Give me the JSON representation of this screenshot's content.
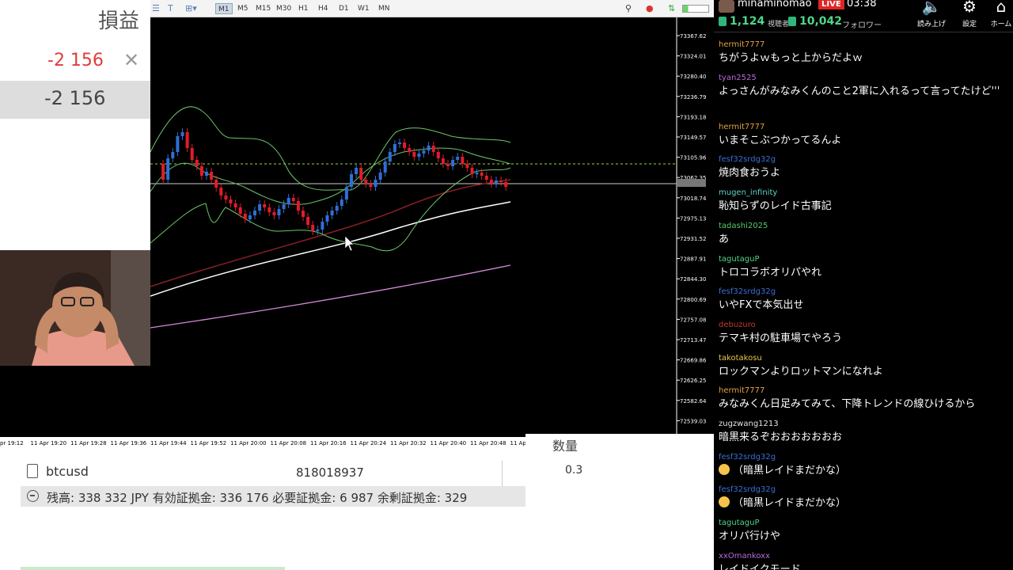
{
  "left_panel": {
    "title": "損益",
    "value": "-2 156",
    "close_symbol": "✕",
    "total": "-2 156"
  },
  "toolbar": {
    "timeframes": [
      "M1",
      "M5",
      "M15",
      "M30",
      "H1",
      "H4",
      "D1",
      "W1",
      "MN"
    ],
    "active_timeframe": "M1"
  },
  "chart": {
    "price_levels": [
      "73367.62",
      "73324.01",
      "73280.40",
      "73236.79",
      "73193.18",
      "73149.57",
      "73105.96",
      "73062.35",
      "73018.74",
      "72975.13",
      "72931.52",
      "72887.91",
      "72844.30",
      "72800.69",
      "72757.08",
      "72713.47",
      "72669.86",
      "72626.25",
      "72582.64",
      "72539.03"
    ],
    "time_labels": [
      "pr 19:12",
      "11 Apr 19:20",
      "11 Apr 19:28",
      "11 Apr 19:36",
      "11 Apr 19:44",
      "11 Apr 19:52",
      "11 Apr 20:00",
      "11 Apr 20:08",
      "11 Apr 20:16",
      "11 Apr 20:24",
      "11 Apr 20:32",
      "11 Apr 20:40",
      "11 Apr 20:48",
      "11 Ap"
    ],
    "colors": {
      "up": "#2f6fd6",
      "down": "#e01d2a",
      "bollinger": "#6ac66a",
      "ma_white": "#ffffff",
      "ma_pink": "#d58ad8",
      "ma_red": "#8a1f24",
      "dotted": "#9bd83a"
    }
  },
  "trade_table": {
    "qty_header": "数量",
    "symbol": "btcusd",
    "order_id": "818018937",
    "qty_value": "0.3",
    "balance_line": "残高: 338 332 JPY  有効証拠金: 336 176  必要証拠金: 6 987  余剰証拠金: 329"
  },
  "chat": {
    "streamer": "minaminomao",
    "live_label": "LIVE",
    "elapsed": "03:38",
    "viewers": "1,124",
    "viewers_label": "視聴者",
    "followers": "10,042",
    "followers_label": "フォロワー",
    "buttons": [
      {
        "label": "読み上げ",
        "icon": "speaker-icon"
      },
      {
        "label": "設定",
        "icon": "gear-icon"
      },
      {
        "label": "ホーム",
        "icon": "home-icon"
      }
    ],
    "messages": [
      {
        "user": "hermit7777",
        "color": "#e6a23c",
        "text": "ちがうよｗもっと上からだよｗ"
      },
      {
        "user": "tyan2525",
        "color": "#b96ad9",
        "text": "よっさんがみなみくんのこと2軍に入れるって言ってたけど'''"
      },
      {
        "user": "hermit7777",
        "color": "#e6a23c",
        "text": "いまそこぶつかってるんよ"
      },
      {
        "user": "fesf32srdg32g",
        "color": "#3b6fd8",
        "text": "焼肉食おうよ"
      },
      {
        "user": "mugen_infinity",
        "color": "#5ad5c8",
        "text": "恥知らずのレイド古事記"
      },
      {
        "user": "tadashi2025",
        "color": "#59c96a",
        "text": "あ"
      },
      {
        "user": "tagutaguP",
        "color": "#4fd68a",
        "text": "トロコラボオリパやれ"
      },
      {
        "user": "fesf32srdg32g",
        "color": "#3b6fd8",
        "text": "いやFXで本気出せ"
      },
      {
        "user": "debuzuro",
        "color": "#c0392b",
        "text": "テマキ村の駐車場でやろう"
      },
      {
        "user": "takotakosu",
        "color": "#e6c84a",
        "text": "ロックマンよりロットマンになれよ"
      },
      {
        "user": "hermit7777",
        "color": "#e6a23c",
        "text": "みなみくん日足みてみて、下降トレンドの線ひけるから"
      },
      {
        "user": "zugzwang1213",
        "color": "#e5e5e5",
        "text": "暗黒来るぞおおおおおおお"
      },
      {
        "user": "fesf32srdg32g",
        "color": "#3b6fd8",
        "text": "（暗黒レイドまだかな）",
        "emoji": true
      },
      {
        "user": "fesf32srdg32g",
        "color": "#3b6fd8",
        "text": "（暗黒レイドまだかな）",
        "emoji": true
      },
      {
        "user": "tagutaguP",
        "color": "#4fd68a",
        "text": "オリパ行けや"
      },
      {
        "user": "xxOmankoxx",
        "color": "#b96ad9",
        "text": "レイドイクモード"
      }
    ]
  }
}
